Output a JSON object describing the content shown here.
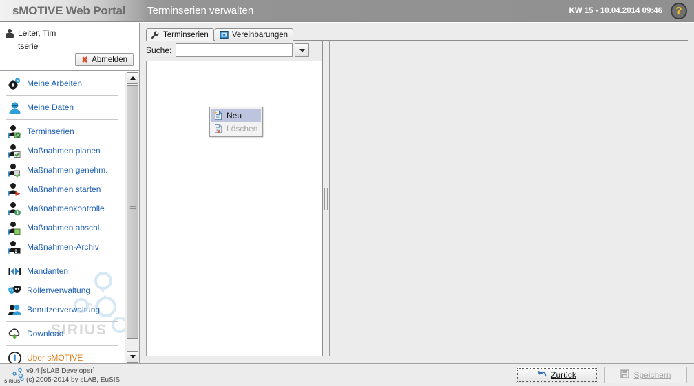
{
  "header": {
    "brand": "sMOTIVE Web Portal",
    "page_title": "Terminserien verwalten",
    "clock": "KW 15 - 10.04.2014 09:46",
    "help_icon": "help-question-icon",
    "help_label": "?"
  },
  "user": {
    "name": "Leiter, Tim",
    "login": "tserie",
    "logout_label": "Abmelden",
    "logout_icon": "red-x-icon",
    "user_icon": "person-icon"
  },
  "sidebar": {
    "watermark": "SIRIUS",
    "items": [
      {
        "label": "Meine Arbeiten",
        "icon": "gears-icon",
        "color": "#1d5fb3",
        "sep_after": true
      },
      {
        "label": "Meine Daten",
        "icon": "user-blue-icon",
        "color": "#1d5fb3",
        "sep_after": true
      },
      {
        "label": "Terminserien",
        "icon": "person-recurrence-icon",
        "color": "#1d5fb3",
        "sep_after": false
      },
      {
        "label": "Maßnahmen planen",
        "icon": "person-plan-icon",
        "color": "#1d5fb3",
        "sep_after": false
      },
      {
        "label": "Maßnahmen genehm.",
        "icon": "person-approve-icon",
        "color": "#1d5fb3",
        "sep_after": false
      },
      {
        "label": "Maßnahmen starten",
        "icon": "person-start-icon",
        "color": "#1d5fb3",
        "sep_after": false
      },
      {
        "label": "Maßnahmenkontrolle",
        "icon": "person-control-icon",
        "color": "#1d5fb3",
        "sep_after": false
      },
      {
        "label": "Maßnahmen abschl.",
        "icon": "person-complete-icon",
        "color": "#1d5fb3",
        "sep_after": false
      },
      {
        "label": "Maßnahmen-Archiv",
        "icon": "person-archive-icon",
        "color": "#1d5fb3",
        "sep_after": true
      },
      {
        "label": "Mandanten",
        "icon": "mandanten-arrows-icon",
        "color": "#1d5fb3",
        "sep_after": false
      },
      {
        "label": "Rollenverwaltung",
        "icon": "masks-icon",
        "color": "#1d5fb3",
        "sep_after": false
      },
      {
        "label": "Benutzerverwaltung",
        "icon": "users-icon",
        "color": "#1d5fb3",
        "sep_after": true
      },
      {
        "label": "Download",
        "icon": "download-cloud-icon",
        "color": "#1d5fb3",
        "sep_after": true
      },
      {
        "label": "Über sMOTIVE",
        "icon": "info-icon",
        "color": "#e07b16",
        "sep_after": false
      }
    ],
    "scroll_up_icon": "scroll-up-arrow-icon",
    "scroll_down_icon": "scroll-down-arrow-icon"
  },
  "main": {
    "tabs": [
      {
        "label": "Terminserien",
        "icon": "wrench-icon",
        "active": true
      },
      {
        "label": "Vereinbarungen",
        "icon": "blue-window-icon",
        "active": false
      }
    ],
    "search": {
      "label": "Suche:",
      "value": "",
      "placeholder": "",
      "dropdown_icon": "chevron-down-icon"
    },
    "list_items": [],
    "context_menu": {
      "items": [
        {
          "label": "Neu",
          "icon": "new-document-icon",
          "selected": true,
          "disabled": false
        },
        {
          "label": "Löschen",
          "icon": "delete-document-icon",
          "selected": false,
          "disabled": true
        }
      ]
    }
  },
  "footer": {
    "version": "v9.4 [sLAB Developer]",
    "copyright": "(c) 2005-2014 by sLAB, EuSIS",
    "logo_text": "SIRIUS",
    "buttons": [
      {
        "label": "Zurück",
        "icon": "back-arrow-icon",
        "disabled": false,
        "focused": true
      },
      {
        "label": "Speichern",
        "icon": "save-disk-icon",
        "disabled": true,
        "focused": false
      }
    ]
  }
}
